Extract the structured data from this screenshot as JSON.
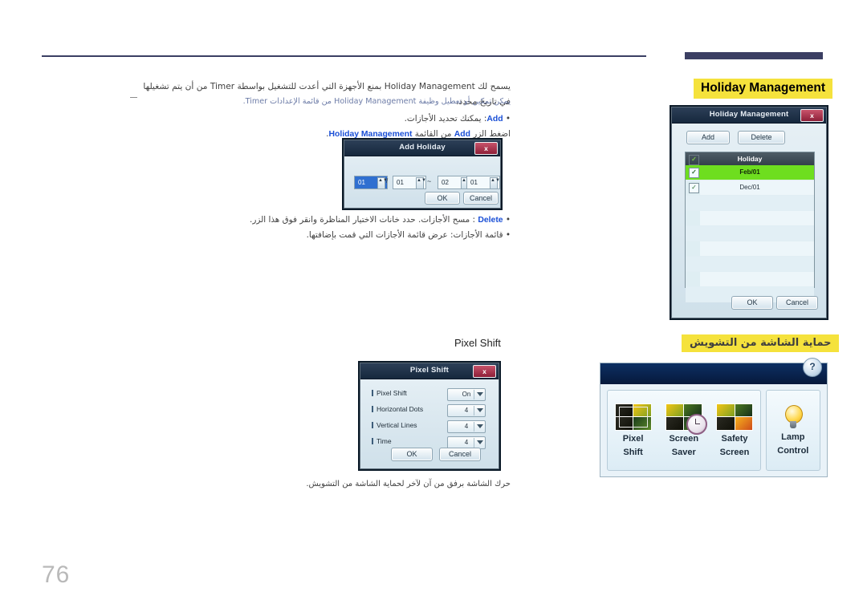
{
  "page": {
    "number": "76"
  },
  "headings": {
    "holiday_management": "Holiday Management",
    "safety_screen_ar": "حماية الشاشة من التشويش",
    "pixel_shift": "Pixel Shift"
  },
  "body": {
    "intro": "يسمح لك Holiday Management بمنع الأجهزة التي أعدت للتشغيل بواسطة Timer من أن يتم تشغيلها في تاريخ محدد.",
    "intro_kw1": "Holiday Management",
    "intro_kw2": "Timer",
    "note": "يمكن تمكين أو تعطيل وظيفة Holiday Management من قائمة الإعدادات Timer.",
    "note_kw1": "Holiday Management",
    "note_kw2": "Timer",
    "bullet_add_kw": "Add",
    "bullet_add": "يمكنك تحديد الأجازات.",
    "bullet_add_sub_pre": "اضغط الزر",
    "bullet_add_sub_kw1": "Add",
    "bullet_add_sub_mid": "من القائمة",
    "bullet_add_sub_kw2": "Holiday Management",
    "bullet_add_sub_end": ".",
    "bullet_delete_kw": "Delete",
    "bullet_delete": ": مسح الأجازات. حدد خانات الاختيار المناظرة وانقر فوق هذا الزر.",
    "bullet_list": "قائمة الأجازات: عرض قائمة الأجازات التي قمت بإضافتها.",
    "caption_bottom": "حرك الشاشة برفق من آن لآخر لحماية الشاشة من التشويش."
  },
  "add_holiday_dialog": {
    "title": "Add Holiday",
    "close_label": "x",
    "start_month": "01",
    "start_day": "01",
    "separator": "~",
    "end_month": "02",
    "end_day": "01",
    "slash": "/",
    "ok": "OK",
    "cancel": "Cancel"
  },
  "holiday_management_dialog": {
    "title": "Holiday Management",
    "close_label": "x",
    "add": "Add",
    "delete": "Delete",
    "column_header": "Holiday",
    "rows": [
      {
        "label": "Feb/01",
        "checked": true,
        "selected": true
      },
      {
        "label": "Dec/01",
        "checked": true,
        "selected": false
      }
    ],
    "empty_rows": 7,
    "check_glyph": "✓",
    "ok": "OK",
    "cancel": "Cancel"
  },
  "pixel_shift_dialog": {
    "title": "Pixel Shift",
    "close_label": "x",
    "rows": [
      {
        "label": "Pixel Shift",
        "value": "On"
      },
      {
        "label": "Horizontal Dots",
        "value": "4"
      },
      {
        "label": "Vertical Lines",
        "value": "4"
      },
      {
        "label": "Time",
        "value": "4"
      }
    ],
    "ok": "OK",
    "cancel": "Cancel"
  },
  "safety_panel": {
    "help_label": "?",
    "tiles": [
      {
        "line1": "Pixel",
        "line2": "Shift"
      },
      {
        "line1": "Screen",
        "line2": "Saver"
      },
      {
        "line1": "Safety",
        "line2": "Screen"
      }
    ],
    "lamp": {
      "line1": "Lamp",
      "line2": "Control"
    }
  },
  "colors": {
    "accent_yellow": "#f5e23c",
    "keyword_blue": "#1a4fd6",
    "rule_navy": "#3b3f63",
    "list_selected_green": "#6ede1f"
  }
}
